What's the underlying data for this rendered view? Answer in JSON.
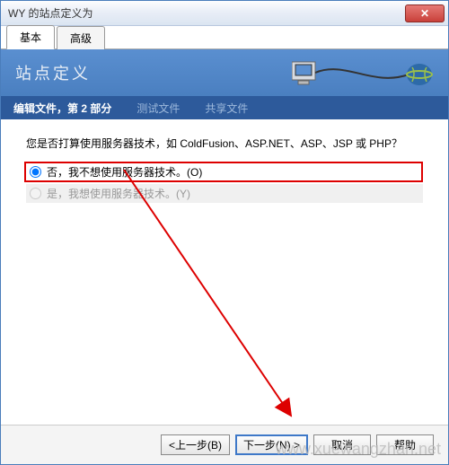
{
  "window": {
    "title": "WY 的站点定义为"
  },
  "tabs": {
    "basic": "基本",
    "advanced": "高级"
  },
  "banner": {
    "title": "站点定义"
  },
  "subheader": {
    "active": "编辑文件，第 2 部分",
    "test": "测试文件",
    "share": "共享文件"
  },
  "content": {
    "question": "您是否打算使用服务器技术，如 ColdFusion、ASP.NET、ASP、JSP 或 PHP？",
    "radio_no": "否，我不想使用服务器技术。(O)",
    "radio_yes": "是，我想使用服务器技术。(Y)"
  },
  "footer": {
    "back": "<上一步(B)",
    "next": "下一步(N) >",
    "cancel": "取消",
    "help": "帮助"
  },
  "watermark": "www.xuewangzhan.net"
}
